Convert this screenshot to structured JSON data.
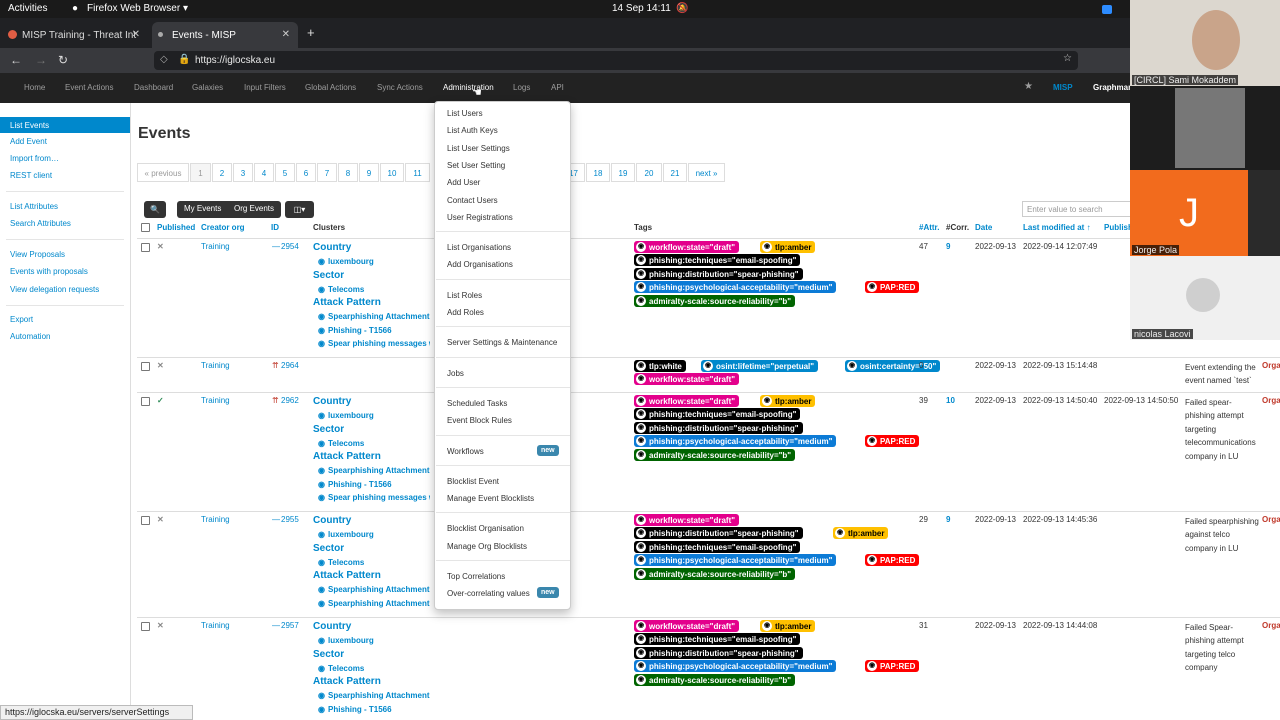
{
  "system": {
    "activities": "Activities",
    "app": "Firefox Web Browser",
    "clock": "14 Sep  14:11"
  },
  "browser": {
    "tabs": [
      {
        "label": "MISP Training - Threat Int"
      },
      {
        "label": "Events - MISP"
      }
    ],
    "url": "https://iglocska.eu",
    "status_url": "https://iglocska.eu/servers/serverSettings"
  },
  "topnav": {
    "items": [
      "Home",
      "Event Actions",
      "Dashboard",
      "Galaxies",
      "Input Filters",
      "Global Actions",
      "Sync Actions",
      "Administration",
      "Logs",
      "API"
    ],
    "brand": "MISP",
    "user": "Graphmar"
  },
  "sidebar": {
    "items": [
      "List Events",
      "Add Event",
      "Import from…",
      "REST client",
      "List Attributes",
      "Search Attributes",
      "View Proposals",
      "Events with proposals",
      "View delegation requests",
      "Export",
      "Automation"
    ]
  },
  "page": {
    "title": "Events"
  },
  "pagination": {
    "items": [
      "« previous",
      "1",
      "2",
      "3",
      "4",
      "5",
      "6",
      "7",
      "8",
      "9",
      "10",
      "11",
      "17",
      "18",
      "19",
      "20",
      "21",
      "next »"
    ]
  },
  "toolbar": {
    "my_events": "My Events",
    "org_events": "Org Events",
    "search_placeholder": "Enter value to search"
  },
  "table": {
    "headers": [
      "Published",
      "Creator org",
      "ID",
      "Clusters",
      "Tags",
      "#Attr.",
      "#Corr.",
      "Date",
      "Last modified at ↑",
      "Publish"
    ],
    "rows": [
      {
        "published": "✕",
        "org": "Training",
        "id": "2954",
        "attr": "47",
        "corr": "9",
        "date": "2022-09-13",
        "modified": "2022-09-14 12:07:49",
        "published_at": "",
        "info": "",
        "clusters": [
          {
            "h": "Country"
          },
          {
            "i": "luxembourg"
          },
          {
            "h": "Sector"
          },
          {
            "i": "Telecoms"
          },
          {
            "h": "Attack Pattern"
          },
          {
            "i": "Spearphishing Attachment -"
          },
          {
            "i": "Phishing - T1566"
          },
          {
            "i": "Spear phishing messages w"
          }
        ],
        "tags": [
          [
            "workflow:state=\"draft\"",
            "tlp:amber"
          ],
          [
            "phishing:techniques=\"email-spoofing\""
          ],
          [
            "phishing:distribution=\"spear-phishing\""
          ],
          [
            "phishing:psychological-acceptability=\"medium\"",
            "PAP:RED"
          ],
          [
            "admiralty-scale:source-reliability=\"b\""
          ]
        ]
      },
      {
        "published": "✕",
        "org": "Training",
        "id": "2964",
        "attr": "0",
        "corr": "",
        "date": "2022-09-13",
        "modified": "2022-09-13 15:14:48",
        "published_at": "",
        "info": "Event extending the event named `test`",
        "clusters": [],
        "tags": [
          [
            "tlp:white",
            "osint:lifetime=\"perpetual\"",
            "osint:certainty=\"50\""
          ],
          [
            "workflow:state=\"draft\""
          ]
        ]
      },
      {
        "published": "✓",
        "org": "Training",
        "id": "2962",
        "attr": "39",
        "corr": "10",
        "date": "2022-09-13",
        "modified": "2022-09-13 14:50:40",
        "published_at": "2022-09-13 14:50:50",
        "info": "Failed spear-phishing attempt targeting telecommunications company in LU",
        "clusters": [
          {
            "h": "Country"
          },
          {
            "i": "luxembourg"
          },
          {
            "h": "Sector"
          },
          {
            "i": "Telecoms"
          },
          {
            "h": "Attack Pattern"
          },
          {
            "i": "Spearphishing Attachment -"
          },
          {
            "i": "Phishing - T1566"
          },
          {
            "i": "Spear phishing messages w"
          }
        ],
        "tags": [
          [
            "workflow:state=\"draft\"",
            "tlp:amber"
          ],
          [
            "phishing:techniques=\"email-spoofing\""
          ],
          [
            "phishing:distribution=\"spear-phishing\""
          ],
          [
            "phishing:psychological-acceptability=\"medium\"",
            "PAP:RED"
          ],
          [
            "admiralty-scale:source-reliability=\"b\""
          ]
        ]
      },
      {
        "published": "✕",
        "org": "Training",
        "id": "2955",
        "attr": "29",
        "corr": "9",
        "date": "2022-09-13",
        "modified": "2022-09-13 14:45:36",
        "published_at": "",
        "info": "Failed spearphishing against telco company in LU",
        "clusters": [
          {
            "h": "Country"
          },
          {
            "i": "luxembourg"
          },
          {
            "h": "Sector"
          },
          {
            "i": "Telecoms"
          },
          {
            "h": "Attack Pattern"
          },
          {
            "i": "Spearphishing Attachment -"
          },
          {
            "i": "Spearphishing Attachment -"
          }
        ],
        "tags": [
          [
            "workflow:state=\"draft\""
          ],
          [
            "phishing:distribution=\"spear-phishing\"",
            "tlp:amber"
          ],
          [
            "phishing:techniques=\"email-spoofing\""
          ],
          [
            "phishing:psychological-acceptability=\"medium\"",
            "PAP:RED"
          ],
          [
            "admiralty-scale:source-reliability=\"b\""
          ]
        ]
      },
      {
        "published": "✕",
        "org": "Training",
        "id": "2957",
        "attr": "31",
        "corr": "",
        "date": "2022-09-13",
        "modified": "2022-09-13 14:44:08",
        "published_at": "",
        "info": "Failed Spear-phishing attempt targeting telco company",
        "clusters": [
          {
            "h": "Country"
          },
          {
            "i": "luxembourg"
          },
          {
            "h": "Sector"
          },
          {
            "i": "Telecoms"
          },
          {
            "h": "Attack Pattern"
          },
          {
            "i": "Spearphishing Attachment - T1566.001"
          },
          {
            "i": "Phishing - T1566"
          }
        ],
        "tags": [
          [
            "workflow:state=\"draft\"",
            "tlp:amber"
          ],
          [
            "phishing:techniques=\"email-spoofing\""
          ],
          [
            "phishing:distribution=\"spear-phishing\""
          ],
          [
            "phishing:psychological-acceptability=\"medium\"",
            "PAP:RED"
          ],
          [
            "admiralty-scale:source-reliability=\"b\""
          ]
        ]
      }
    ],
    "org_label": "Orga"
  },
  "admin_menu": {
    "groups": [
      [
        "List Users",
        "List Auth Keys",
        "List User Settings",
        "Set User Setting",
        "Add User",
        "Contact Users",
        "User Registrations"
      ],
      [
        "List Organisations",
        "Add Organisations"
      ],
      [
        "List Roles",
        "Add Roles"
      ],
      [
        "Server Settings & Maintenance"
      ],
      [
        "Jobs"
      ],
      [
        "Scheduled Tasks",
        "Event Block Rules"
      ],
      [
        "Workflows"
      ],
      [
        "Blocklist Event",
        "Manage Event Blocklists"
      ],
      [
        "Blocklist Organisation",
        "Manage Org Blocklists"
      ],
      [
        "Top Correlations",
        "Over-correlating values"
      ]
    ],
    "new_badge": "new"
  },
  "video": {
    "participants": [
      "[CIRCL] Sami Mokaddem",
      "",
      "Jorge Pola",
      "nicolas Lacovi"
    ],
    "avatar_letter": "J"
  },
  "colors": {
    "accent": "#0088cc",
    "navbar": "#222222",
    "draft": "#e3008c",
    "amber": "#ffc000",
    "tlpwhite": "#000000",
    "osint": "#0088cc",
    "phishblack": "#000000",
    "medium": "#0c7bd6",
    "papred": "#ff0000",
    "admiralty": "#006400"
  }
}
